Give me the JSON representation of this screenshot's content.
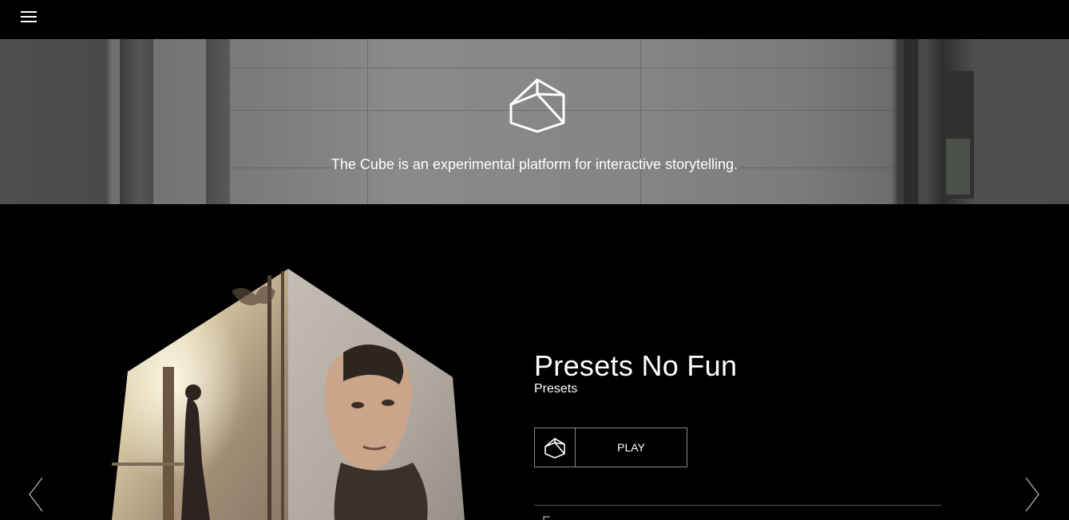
{
  "header": {
    "menu_icon": "hamburger-menu-icon"
  },
  "hero": {
    "logo_icon": "cube-logo-icon",
    "tagline": "The Cube is an experimental platform for interactive storytelling."
  },
  "feature": {
    "title": "Presets No Fun",
    "subtitle": "Presets",
    "play_label": "PLAY",
    "play_icon": "cube-icon"
  },
  "navigation": {
    "prev_icon": "chevron-left-icon",
    "next_icon": "chevron-right-icon"
  },
  "colors": {
    "background": "#000000",
    "border": "#8a8a8a",
    "divider": "#555555",
    "text": "#ffffff"
  }
}
